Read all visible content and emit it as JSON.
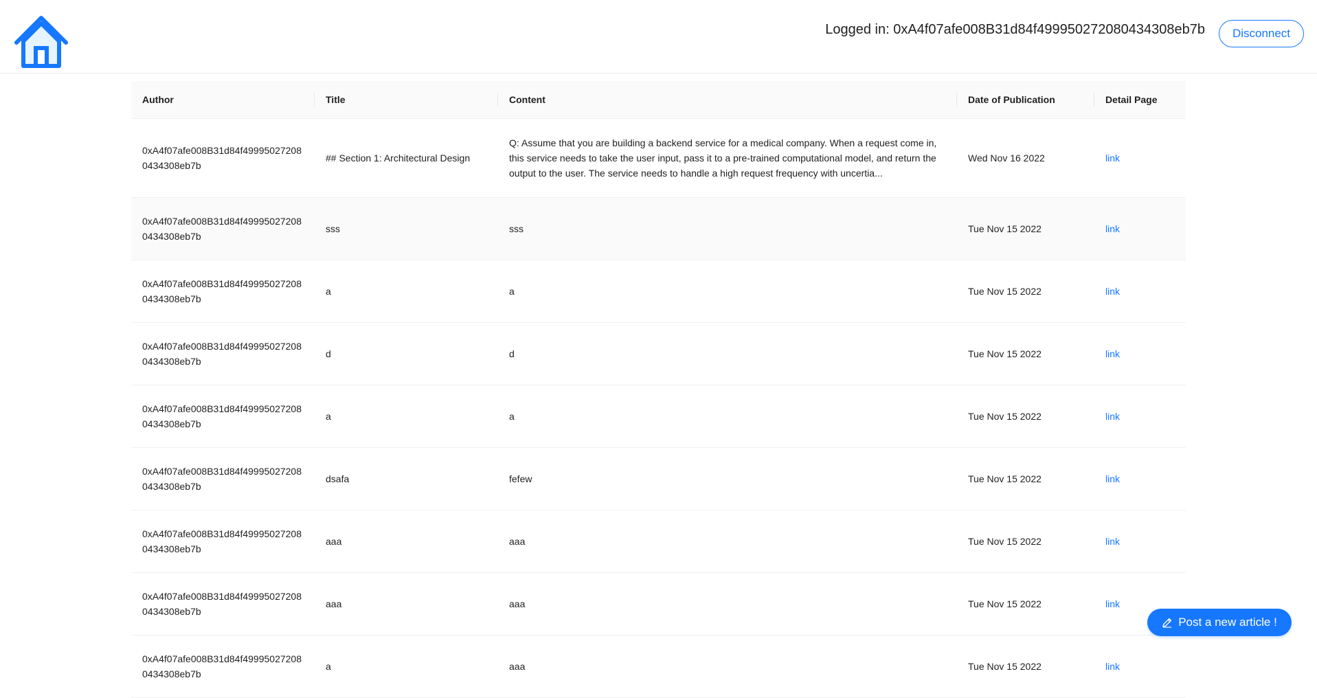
{
  "header": {
    "home_icon": "home-icon",
    "login_text": "Logged in: 0xA4f07afe008B31d84f499950272080434308eb7b",
    "disconnect_label": "Disconnect"
  },
  "table": {
    "columns": [
      "Author",
      "Title",
      "Content",
      "Date of Publication",
      "Detail Page"
    ],
    "rows": [
      {
        "author": "0xA4f07afe008B31d84f499950272080434308eb7b",
        "title": "## Section 1: Architectural Design",
        "content": "Q: Assume that you are building a backend service for a medical company. When a request come in, this service needs to take the user input, pass it to a pre-trained computational model, and return the output to the user. The service needs to handle a high request frequency with uncertia...",
        "date": "Wed Nov 16 2022",
        "link": "link"
      },
      {
        "author": "0xA4f07afe008B31d84f499950272080434308eb7b",
        "title": "sss",
        "content": "sss",
        "date": "Tue Nov 15 2022",
        "link": "link"
      },
      {
        "author": "0xA4f07afe008B31d84f499950272080434308eb7b",
        "title": "a",
        "content": "a",
        "date": "Tue Nov 15 2022",
        "link": "link"
      },
      {
        "author": "0xA4f07afe008B31d84f499950272080434308eb7b",
        "title": "d",
        "content": "d",
        "date": "Tue Nov 15 2022",
        "link": "link"
      },
      {
        "author": "0xA4f07afe008B31d84f499950272080434308eb7b",
        "title": "a",
        "content": "a",
        "date": "Tue Nov 15 2022",
        "link": "link"
      },
      {
        "author": "0xA4f07afe008B31d84f499950272080434308eb7b",
        "title": "dsafa",
        "content": "fefew",
        "date": "Tue Nov 15 2022",
        "link": "link"
      },
      {
        "author": "0xA4f07afe008B31d84f499950272080434308eb7b",
        "title": "aaa",
        "content": "aaa",
        "date": "Tue Nov 15 2022",
        "link": "link"
      },
      {
        "author": "0xA4f07afe008B31d84f499950272080434308eb7b",
        "title": "aaa",
        "content": "aaa",
        "date": "Tue Nov 15 2022",
        "link": "link"
      },
      {
        "author": "0xA4f07afe008B31d84f499950272080434308eb7b",
        "title": "a",
        "content": "aaa",
        "date": "Tue Nov 15 2022",
        "link": "link"
      }
    ]
  },
  "post_button": {
    "label": "Post a new article !",
    "icon": "edit-icon"
  },
  "colors": {
    "accent": "#1677ff",
    "header_bg": "#fafafa"
  }
}
